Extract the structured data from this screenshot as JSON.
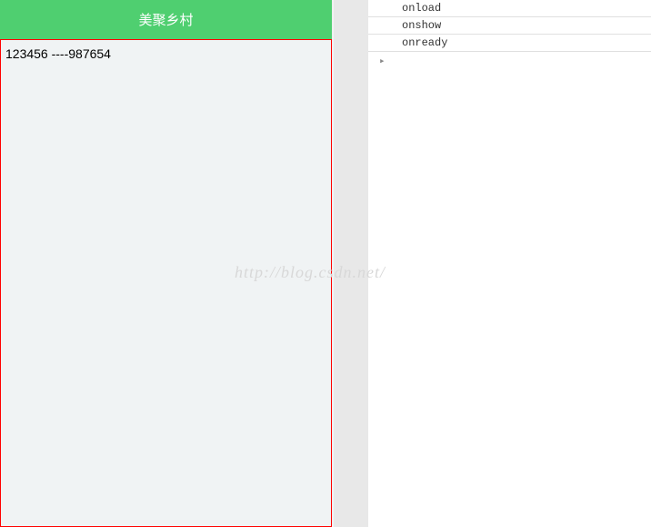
{
  "phone": {
    "title": "美聚乡村",
    "content": "123456 ----987654"
  },
  "console": {
    "rows": [
      "onload",
      "onshow",
      "onready"
    ],
    "expand_symbol": "▸"
  },
  "watermark": "http://blog.csdn.net/"
}
